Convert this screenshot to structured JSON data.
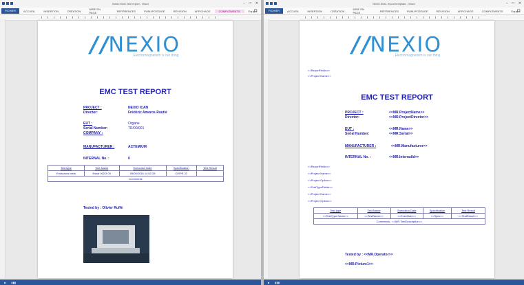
{
  "left_window": {
    "title": "Nexio EMC test report - Word",
    "tabs": [
      "FICHIER",
      "ACCUEIL",
      "INSERTION",
      "CRÉATION",
      "MISE EN PAGE",
      "RÉFÉRENCES",
      "PUBLIPOSTAGE",
      "RÉVISION",
      "AFFICHAGE",
      "COMPLÉMENTS",
      "Equipe"
    ],
    "document": {
      "logo_word": "NEXIO",
      "logo_tagline": "Electromagnetism is our thing",
      "report_title": "EMC TEST REPORT",
      "project_label": "PROJECT :",
      "director_label": "Director:",
      "project_value": "NEXIO ICAN",
      "director_value": "Frédéric Amoros Routié",
      "eut_label": "EUT :",
      "serial_label": "Serial Number:",
      "company_label": "COMPANY :",
      "eut_value": "Organe",
      "serial_value": "TR/00/001",
      "manufacturer_label": "MANUFACTURER :",
      "manufacturer_value": "ACTEMIUM",
      "internal_label": "INTERNAL No. :",
      "internal_value": "0",
      "table_headers": [
        "Test type",
        "Test Name",
        "Execution Date",
        "Specification",
        "Test Result"
      ],
      "table_row": [
        "Emissions tests",
        "Essai 002/2 00",
        "05/05/2016 14:52:33",
        "CISPR 22",
        ""
      ],
      "comments": "Comments",
      "tested_by": "Tested by : Olivier Ruffé"
    }
  },
  "right_window": {
    "title": "Nexio EMC report template - Word",
    "tabs": [
      "FICHIER",
      "ACCUEIL",
      "INSERTION",
      "CRÉATION",
      "MISE EN PAGE",
      "RÉFÉRENCES",
      "PUBLIPOSTAGE",
      "RÉVISION",
      "AFFICHAGE",
      "COMPLÉMENTS",
      "Equipe"
    ],
    "document": {
      "logo_word": "NEXIO",
      "logo_tagline": "Electromagnetism is our thing",
      "top_line1": "<<ReportFields>>",
      "top_line2": "<<Project Name>>",
      "report_title": "EMC TEST REPORT",
      "project_label": "PROJECT :",
      "director_label": "Director:",
      "project_value": "<<MR.ProjectName>>",
      "director_value": "<<MR.ProjectDirector>>",
      "eut_label": "EUT :",
      "serial_label": "Serial Number:",
      "eut_value": "<<MR.Name>>",
      "serial_value": "<<MR.Serial>>",
      "manufacturer_label": "MANUFACTURER :",
      "manufacturer_value": "<<MR.Manufacturer>>",
      "internal_label": "INTERNAL No. :",
      "internal_value": "<<MR.InternalId>>",
      "list": [
        "<<ReportFields>>",
        "<<Project Name>>",
        "<<Project Option>>",
        "<<TestTypeFields>>",
        "<<Project Name>>",
        "<<Project Option>>"
      ],
      "table_headers": [
        "Test type",
        "Test Name",
        "Execution Date",
        "Specification",
        "Test Result"
      ],
      "table_row": [
        "<<TestType.Name>>",
        "<<TestName>>",
        "<<ExecDate>>",
        "<<Spec>>",
        "<<TestResult>>"
      ],
      "comments": "Comments : <<MR.TestDescription>>",
      "tested_by": "Tested by : <<MR.Operator>>",
      "picture": "<<MR.Picture1>>"
    }
  }
}
